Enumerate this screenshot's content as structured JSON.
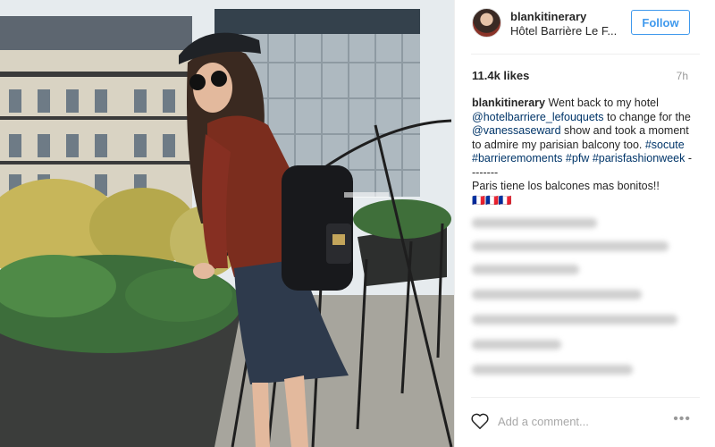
{
  "post": {
    "photo_icon": "photo-icon",
    "header": {
      "username": "blankitinerary",
      "location": "Hôtel Barrière Le F...",
      "follow_label": "Follow"
    },
    "likes": "11.4k likes",
    "time": "7h",
    "caption": {
      "username": "blankitinerary",
      "text1": "Went back to my hotel",
      "mention1": "@hotelbarriere_lefouquets",
      "text2": "to change for the",
      "mention2": "@vanessaseward",
      "text3": "show and took a moment to admire my parisian balcony too.",
      "tag1": "#socute",
      "tag2": "#barrieremoments",
      "tag3": "#pfw",
      "tag4": "#parisfashionweek",
      "dashes": "--------",
      "line2": "Paris tiene los balcones mas bonitos!!",
      "emoji": "🇫🇷🇫🇷🇫🇷"
    },
    "comment_placeholder": "Add a comment...",
    "icons": {
      "heart": "heart-icon",
      "more": "more-options-icon"
    }
  },
  "colors": {
    "accent": "#3f99ed",
    "link": "#003569",
    "muted": "#999999"
  }
}
